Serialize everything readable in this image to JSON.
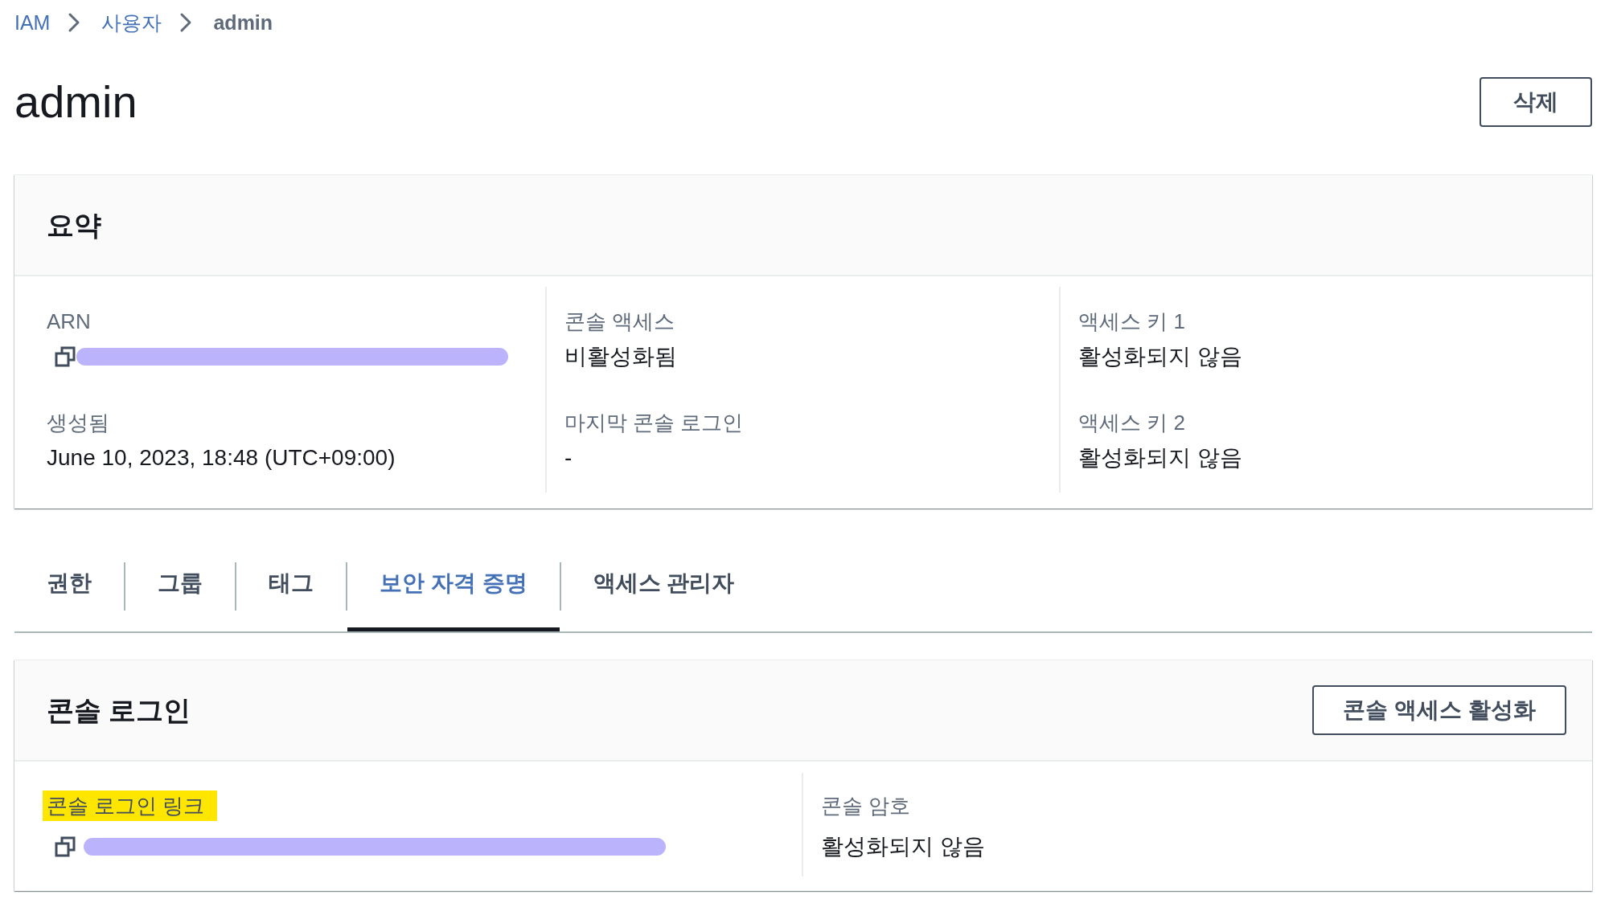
{
  "breadcrumb": [
    {
      "label": "IAM",
      "kind": "link"
    },
    {
      "label": "사용자",
      "kind": "link"
    },
    {
      "label": "admin",
      "kind": "current"
    }
  ],
  "title": "admin",
  "page_button": {
    "label": "삭제"
  },
  "summary": {
    "title": "요약",
    "columns": [
      {
        "fields": [
          {
            "label": "ARN",
            "kind": "copyable",
            "redacted": true
          },
          {
            "label": "생성됨",
            "kind": "text",
            "value": "June 10, 2023, 18:48 (UTC+09:00)"
          }
        ]
      },
      {
        "fields": [
          {
            "label": "콘솔 액세스",
            "kind": "text",
            "value": "비활성화됨"
          },
          {
            "label": "마지막 콘솔 로그인",
            "kind": "text",
            "value": "-"
          }
        ]
      },
      {
        "fields": [
          {
            "label": "액세스 키 1",
            "kind": "text",
            "value": "활성화되지 않음"
          },
          {
            "label": "액세스 키 2",
            "kind": "text",
            "value": "활성화되지 않음"
          }
        ]
      }
    ]
  },
  "tabs": [
    {
      "label": "권한",
      "selected": false
    },
    {
      "label": "그룹",
      "selected": false
    },
    {
      "label": "태그",
      "selected": false
    },
    {
      "label": "보안 자격 증명",
      "selected": true
    },
    {
      "label": "액세스 관리자",
      "selected": false
    }
  ],
  "console_login": {
    "title": "콘솔 로그인",
    "button": "콘솔 액세스 활성화",
    "columns": [
      {
        "fields": [
          {
            "label": "콘솔 로그인 링크",
            "kind": "copyable",
            "redacted": true,
            "highlighted": true
          }
        ]
      },
      {
        "fields": [
          {
            "label": "콘솔 암호",
            "kind": "text",
            "value": "활성화되지 않음",
            "highlighted": false
          }
        ]
      }
    ]
  }
}
